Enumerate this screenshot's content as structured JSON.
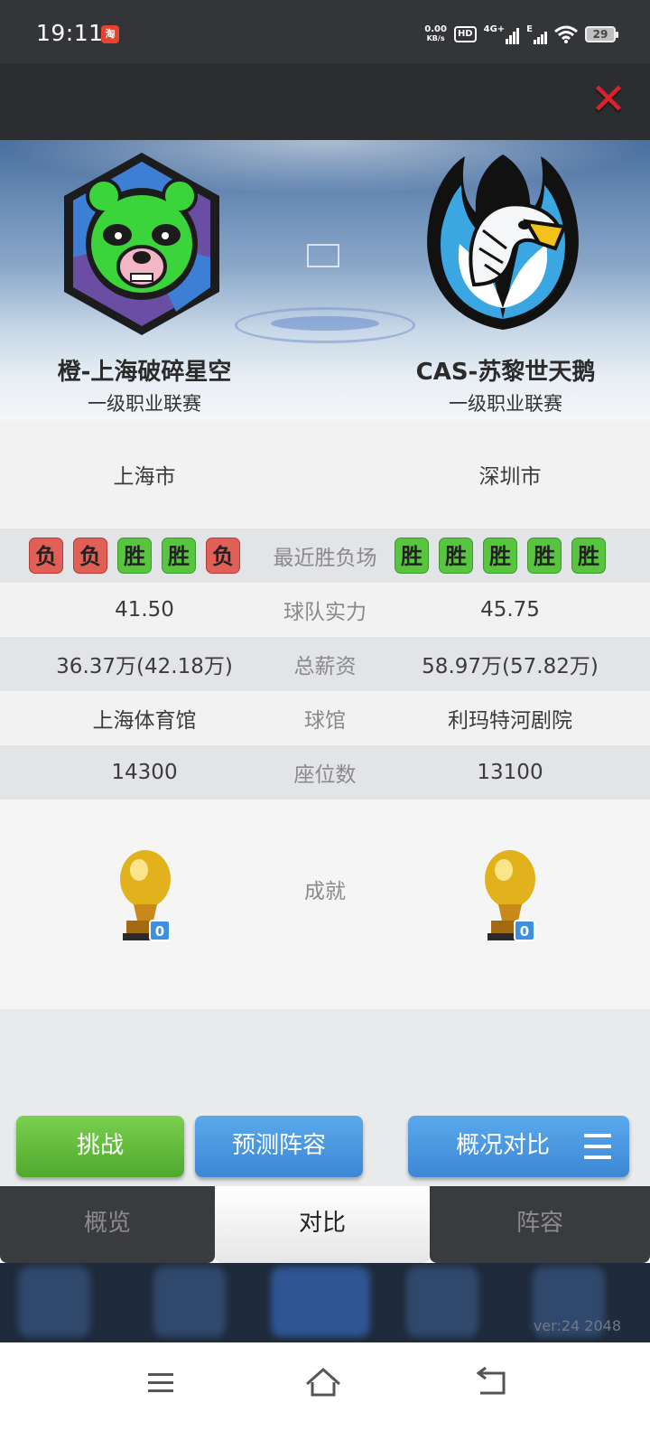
{
  "status_bar": {
    "time": "19:11",
    "app_icon": "淘",
    "net_speed_value": "0.00",
    "net_speed_unit": "KB/s",
    "hd": "HD",
    "network_1": "4G+",
    "network_2": "E",
    "battery": "29"
  },
  "window": {
    "close_icon": "close-icon"
  },
  "teams": {
    "left": {
      "name": "橙-上海破碎星空",
      "league": "一级职业联赛",
      "city": "上海市",
      "logo": "panda-logo"
    },
    "right": {
      "name": "CAS-苏黎世天鹅",
      "league": "一级职业联赛",
      "city": "深圳市",
      "logo": "eagle-logo"
    }
  },
  "comparison": {
    "recent": {
      "label": "最近胜负场",
      "left": [
        "负",
        "负",
        "胜",
        "胜",
        "负"
      ],
      "right": [
        "胜",
        "胜",
        "胜",
        "胜",
        "胜"
      ]
    },
    "strength": {
      "label": "球队实力",
      "left": "41.50",
      "right": "45.75"
    },
    "salary": {
      "label": "总薪资",
      "left": "36.37万(42.18万)",
      "right": "58.97万(57.82万)"
    },
    "arena": {
      "label": "球馆",
      "left": "上海体育馆",
      "right": "利玛特河剧院"
    },
    "seats": {
      "label": "座位数",
      "left": "14300",
      "right": "13100"
    },
    "achievement": {
      "label": "成就",
      "left_count": "0",
      "right_count": "0"
    }
  },
  "actions": {
    "challenge": "挑战",
    "predict_lineup": "预测阵容",
    "overview_compare": "概况对比"
  },
  "tabs": [
    {
      "label": "概览",
      "active": false
    },
    {
      "label": "对比",
      "active": true
    },
    {
      "label": "阵容",
      "active": false
    }
  ],
  "version": "ver:24  2048",
  "colors": {
    "win": "#59c43f",
    "loss": "#e05f57",
    "accent_blue": "#4a97e0",
    "accent_green": "#62bb3c",
    "close_red": "#d8232a"
  }
}
